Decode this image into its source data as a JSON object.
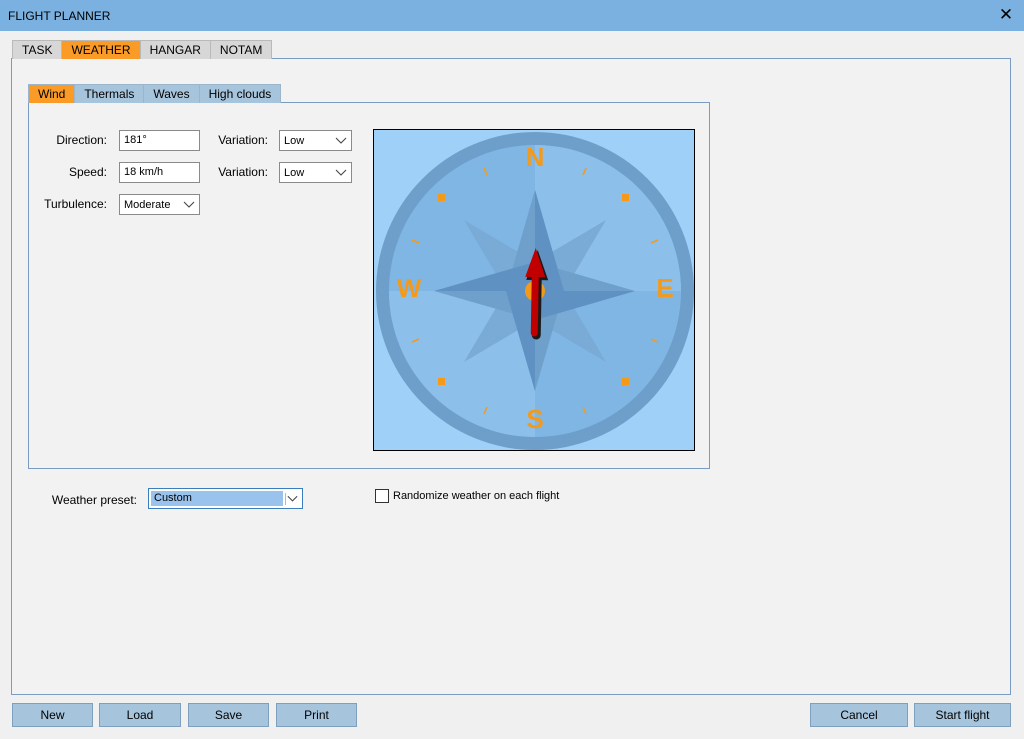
{
  "window": {
    "title": "FLIGHT PLANNER"
  },
  "main_tabs": [
    {
      "label": "TASK"
    },
    {
      "label": "WEATHER"
    },
    {
      "label": "HANGAR"
    },
    {
      "label": "NOTAM"
    }
  ],
  "active_main_tab": "WEATHER",
  "sub_tabs": [
    {
      "label": "Wind"
    },
    {
      "label": "Thermals"
    },
    {
      "label": "Waves"
    },
    {
      "label": "High clouds"
    }
  ],
  "active_sub_tab": "Wind",
  "wind": {
    "direction_label": "Direction:",
    "direction_value": "181°",
    "speed_label": "Speed:",
    "speed_value": "18 km/h",
    "turbulence_label": "Turbulence:",
    "turbulence_value": "Moderate",
    "variation1_label": "Variation:",
    "variation1_value": "Low",
    "variation2_label": "Variation:",
    "variation2_value": "Low"
  },
  "compass": {
    "n": "N",
    "e": "E",
    "s": "S",
    "w": "W",
    "arrow_heading_deg": 1,
    "colors": {
      "background": "#9ed0f8",
      "ring": "#6d9fca",
      "face": "#80b6e4",
      "marker": "#f59a18",
      "arrow": "#c00000"
    }
  },
  "preset": {
    "label": "Weather preset:",
    "value": "Custom"
  },
  "randomize": {
    "label": "Randomize weather on each flight",
    "checked": false
  },
  "buttons": {
    "new": "New",
    "load": "Load",
    "save": "Save",
    "print": "Print",
    "cancel": "Cancel",
    "start": "Start flight"
  },
  "colors": {
    "titlebar": "#7ab1e0",
    "active_tab": "#fa9b28",
    "button": "#a6c4dc"
  }
}
